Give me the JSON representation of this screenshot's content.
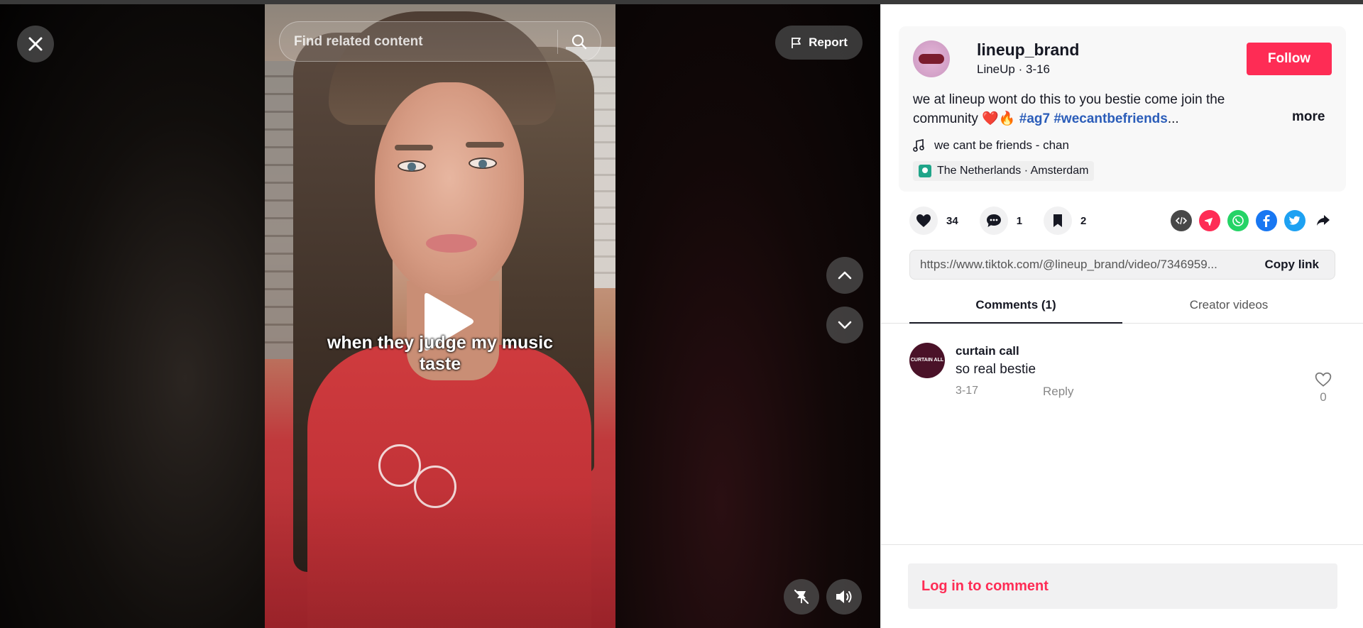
{
  "search": {
    "placeholder": "Find related content"
  },
  "video": {
    "report_label": "Report",
    "caption_line1": "when they judge my music",
    "caption_line2": "taste"
  },
  "post": {
    "username": "lineup_brand",
    "display_name": "LineUp",
    "date": "3-16",
    "subline_sep": " · ",
    "follow_label": "Follow",
    "description": "we at lineup wont do this to you bestie come join the community ",
    "emojis": "❤️🔥",
    "hashtag1": "#ag7",
    "hashtag2": "#wecantbefriends",
    "ellipsis": "...",
    "more_label": "more",
    "music": "we cant be friends - chan",
    "location": "The Netherlands · Amsterdam"
  },
  "stats": {
    "likes": "34",
    "comments": "1",
    "saves": "2"
  },
  "share_icons": [
    "embed-icon",
    "send-icon",
    "whatsapp-icon",
    "facebook-icon",
    "twitter-icon",
    "share-arrow-icon"
  ],
  "link": {
    "url": "https://www.tiktok.com/@lineup_brand/video/7346959...",
    "copy_label": "Copy link"
  },
  "tabs": [
    {
      "label": "Comments (1)",
      "active": true
    },
    {
      "label": "Creator videos",
      "active": false
    }
  ],
  "comments": [
    {
      "author": "curtain call",
      "avatar_text": "CURTAIN ALL",
      "text": "so real bestie",
      "date": "3-17",
      "reply_label": "Reply",
      "likes": "0"
    }
  ],
  "login_label": "Log in to comment",
  "colors": {
    "accent": "#fe2c55",
    "hashtag": "#2b5db9"
  }
}
